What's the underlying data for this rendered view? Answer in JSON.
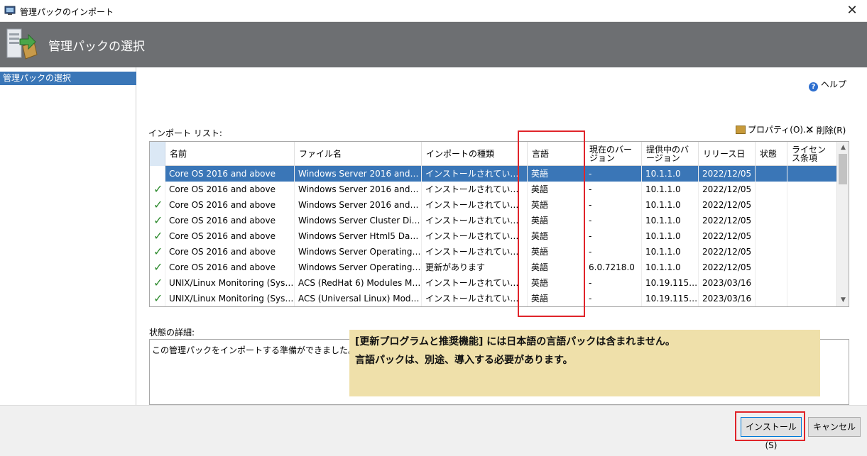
{
  "window": {
    "title": "管理パックのインポート",
    "close": "✕"
  },
  "header": {
    "title": "管理パックの選択"
  },
  "nav": {
    "items": [
      {
        "label": "管理パックの選択"
      }
    ]
  },
  "help": {
    "label": "ヘルプ",
    "icon": "question-icon"
  },
  "toolbar": {
    "import_list_label": "インポート リスト:",
    "properties_label": "プロパティ(O)...",
    "delete_label": "削除(R)"
  },
  "grid": {
    "columns": [
      "名前",
      "ファイル名",
      "インポートの種類",
      "言語",
      "現在のバージョン",
      "提供中のバージョン",
      "リリース日",
      "状態",
      "ライセンス条項"
    ],
    "rows": [
      {
        "name": "Core OS 2016 and above",
        "file": "Windows Server 2016 and above ...",
        "type": "インストールされていません",
        "lang": "英語",
        "current": "-",
        "offered": "10.1.1.0",
        "date": "2022/12/05",
        "state": "",
        "license": ""
      },
      {
        "name": "Core OS 2016 and above",
        "file": "Windows Server 2016 and above ...",
        "type": "インストールされていません",
        "lang": "英語",
        "current": "-",
        "offered": "10.1.1.0",
        "date": "2022/12/05",
        "state": "",
        "license": ""
      },
      {
        "name": "Core OS 2016 and above",
        "file": "Windows Server 2016 and above ...",
        "type": "インストールされていません",
        "lang": "英語",
        "current": "-",
        "offered": "10.1.1.0",
        "date": "2022/12/05",
        "state": "",
        "license": ""
      },
      {
        "name": "Core OS 2016 and above",
        "file": "Windows Server Cluster Disks Mo...",
        "type": "インストールされていません",
        "lang": "英語",
        "current": "-",
        "offered": "10.1.1.0",
        "date": "2022/12/05",
        "state": "",
        "license": ""
      },
      {
        "name": "Core OS 2016 and above",
        "file": "Windows Server Html5 Dashboard",
        "type": "インストールされていません",
        "lang": "英語",
        "current": "-",
        "offered": "10.1.1.0",
        "date": "2022/12/05",
        "state": "",
        "license": ""
      },
      {
        "name": "Core OS 2016 and above",
        "file": "Windows Server Operating Syste...",
        "type": "インストールされていません",
        "lang": "英語",
        "current": "-",
        "offered": "10.1.1.0",
        "date": "2022/12/05",
        "state": "",
        "license": ""
      },
      {
        "name": "Core OS 2016 and above",
        "file": "Windows Server Operating Syste...",
        "type": "更新があります",
        "lang": "英語",
        "current": "6.0.7218.0",
        "offered": "10.1.1.0",
        "date": "2022/12/05",
        "state": "",
        "license": ""
      },
      {
        "name": "UNIX/Linux Monitoring (System C...",
        "file": "ACS (RedHat 6) Modules Manage...",
        "type": "インストールされていません",
        "lang": "英語",
        "current": "-",
        "offered": "10.19.1158.0",
        "date": "2023/03/16",
        "state": "",
        "license": ""
      },
      {
        "name": "UNIX/Linux Monitoring (System C...",
        "file": "ACS (Universal Linux) Modules Ma...",
        "type": "インストールされていません",
        "lang": "英語",
        "current": "-",
        "offered": "10.19.1158.0",
        "date": "2023/03/16",
        "state": "",
        "license": ""
      }
    ]
  },
  "details": {
    "label": "状態の詳細:",
    "text": "この管理パックをインポートする準備ができました。"
  },
  "note": {
    "line1": "[更新プログラムと推奨機能] には日本語の言語パックは含まれません。",
    "line2": "言語パックは、別途、導入する必要があります。"
  },
  "buttons": {
    "install": "インストール(S)",
    "cancel": "キャンセル"
  },
  "colors": {
    "selection": "#3a76b7",
    "highlight": "#e0242a",
    "note_bg": "#efe0aa",
    "header_bg": "#6d6f72"
  }
}
